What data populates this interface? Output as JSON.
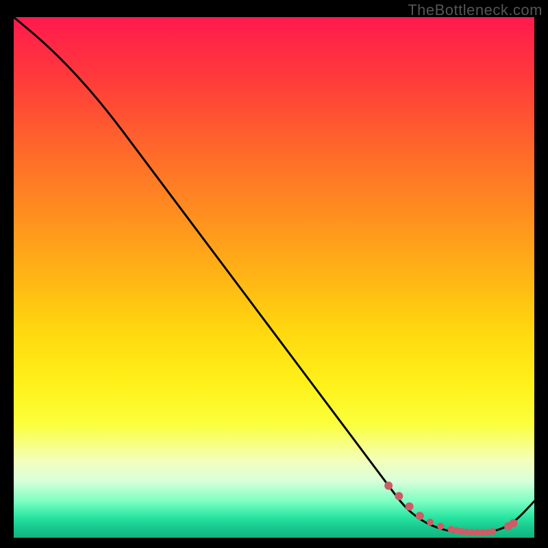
{
  "watermark": "TheBottleneck.com",
  "chart_data": {
    "type": "line",
    "title": "",
    "xlabel": "",
    "ylabel": "",
    "xlim": [
      0,
      100
    ],
    "ylim": [
      0,
      100
    ],
    "grid": false,
    "legend": false,
    "series": [
      {
        "name": "bottleneck-curve",
        "x": [
          0,
          6,
          12,
          18,
          24,
          30,
          36,
          42,
          48,
          54,
          60,
          66,
          72,
          75,
          78,
          81,
          84,
          87,
          90,
          93,
          96,
          100
        ],
        "y": [
          100,
          95,
          89,
          82,
          74,
          66,
          58,
          50,
          42,
          34,
          26,
          18,
          10,
          6,
          3.5,
          2,
          1.2,
          1,
          1,
          1.4,
          2.8,
          7
        ],
        "color": "#000000"
      }
    ],
    "dots": {
      "name": "highlight-dots",
      "color": "#cc5c66",
      "x": [
        72,
        74,
        76,
        78,
        80,
        82,
        84,
        85,
        86,
        87,
        88,
        89,
        90,
        91,
        92,
        95,
        96
      ],
      "y": [
        10,
        8,
        6,
        4.2,
        3.0,
        2.2,
        1.6,
        1.4,
        1.2,
        1.1,
        1.05,
        1.0,
        1.0,
        1.05,
        1.2,
        2.2,
        2.8
      ]
    },
    "background": {
      "gradient": [
        {
          "stop": 0.0,
          "color": "#ff1a4d"
        },
        {
          "stop": 0.5,
          "color": "#ffd70f"
        },
        {
          "stop": 0.78,
          "color": "#fbff3a"
        },
        {
          "stop": 0.93,
          "color": "#7dffc3"
        },
        {
          "stop": 1.0,
          "color": "#10b47f"
        }
      ]
    }
  }
}
